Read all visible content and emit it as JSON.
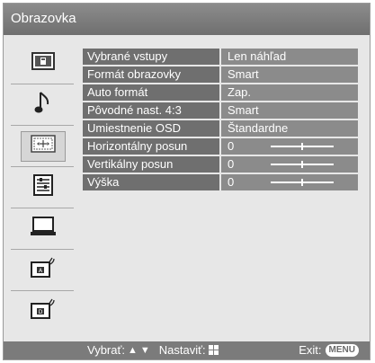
{
  "window": {
    "title": "Obrazovka"
  },
  "sidebar": {
    "items": [
      {
        "icon": "picture-icon",
        "selected": false
      },
      {
        "icon": "music-note-icon",
        "selected": false
      },
      {
        "icon": "screen-adjust-icon",
        "selected": true
      },
      {
        "icon": "settings-list-icon",
        "selected": false
      },
      {
        "icon": "monitor-icon",
        "selected": false
      },
      {
        "icon": "analog-tv-icon",
        "selected": false
      },
      {
        "icon": "digital-tv-icon",
        "selected": false
      }
    ]
  },
  "menu": {
    "rows": [
      {
        "label": "Vybrané vstupy",
        "value": "Len náhľad"
      },
      {
        "label": "Formát obrazovky",
        "value": "Smart"
      },
      {
        "label": "Auto formát",
        "value": "Zap."
      },
      {
        "label": "Pôvodné nast. 4:3",
        "value": "Smart"
      },
      {
        "label": "Umiestnenie OSD",
        "value": "Štandardne"
      },
      {
        "label": "Horizontálny posun",
        "value": "0",
        "slider_fraction": 0.5
      },
      {
        "label": "Vertikálny posun",
        "value": "0",
        "slider_fraction": 0.5
      },
      {
        "label": "Výška",
        "value": "0",
        "slider_fraction": 0.5
      }
    ]
  },
  "footer": {
    "select_label": "Vybrať:",
    "set_label": "Nastaviť:",
    "exit_label": "Exit:",
    "menu_key": "MENU"
  },
  "colors": {
    "background": "#e7e7e7",
    "title_bar": "#7a7a7a",
    "label_cell": "#6f6f6f",
    "value_cell": "#8b8b8b",
    "text": "#ffffff"
  }
}
